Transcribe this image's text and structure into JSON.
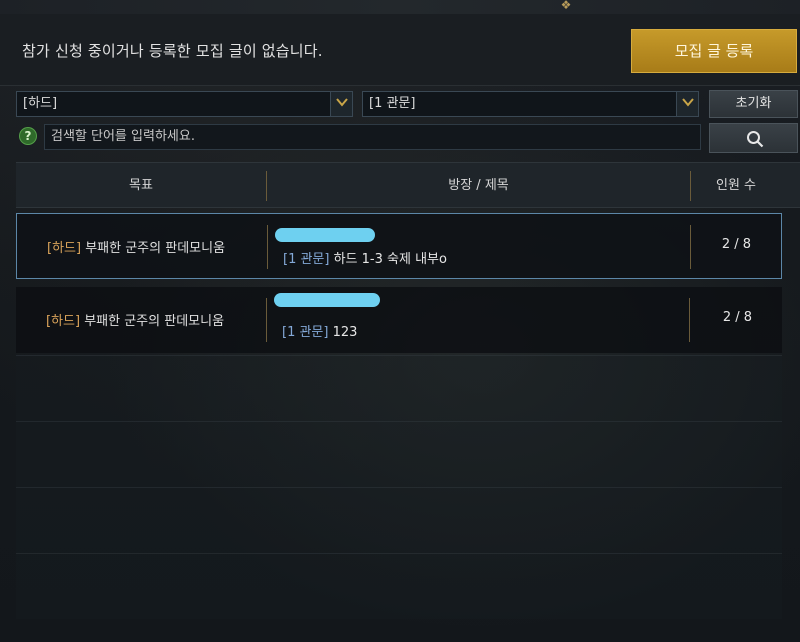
{
  "header": {
    "notice": "참가 신청 중이거나 등록한 모집 글이 없습니다.",
    "register_label": "모집 글 등록"
  },
  "filters": {
    "difficulty": "[하드]",
    "stage": "[1 관문]",
    "reset_label": "초기화"
  },
  "search": {
    "placeholder": "검색할 단어를 입력하세요.",
    "help_glyph": "?"
  },
  "table": {
    "columns": {
      "goal": "목표",
      "leader_title": "방장 / 제목",
      "members": "인원 수"
    },
    "rows": [
      {
        "difficulty_tag": "[하드]",
        "goal": " 부패한 군주의 판데모니움",
        "stage_tag": "[1 관문]",
        "title": " 하드 1-3 숙제 내부o",
        "members": "2 / 8"
      },
      {
        "difficulty_tag": "[하드]",
        "goal": " 부패한 군주의 판데모니움",
        "stage_tag": "[1 관문]",
        "title": " 123",
        "members": "2 / 8"
      }
    ]
  },
  "icons": {
    "dropdown": "chevron-down-icon",
    "search": "search-icon",
    "help": "help-icon"
  },
  "colors": {
    "accent_gold": "#c69a2a",
    "difficulty_tag": "#d9a35a",
    "stage_tag": "#84a9d8",
    "selected_border": "#5c87a8",
    "redaction": "#6ed0f0"
  }
}
